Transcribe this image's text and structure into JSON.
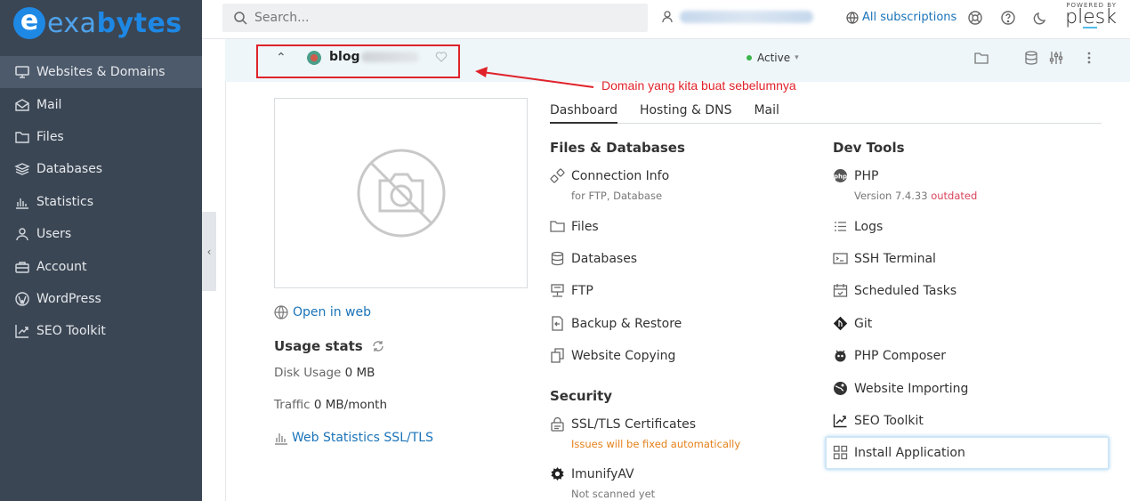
{
  "brand": {
    "logo_letter": "e",
    "logo_text_a": "exa",
    "logo_text_b": "bytes"
  },
  "sidebar": {
    "items": [
      {
        "label": "Websites & Domains",
        "icon": "monitor-icon",
        "active": true
      },
      {
        "label": "Mail",
        "icon": "mail-icon"
      },
      {
        "label": "Files",
        "icon": "folder-icon"
      },
      {
        "label": "Databases",
        "icon": "database-icon"
      },
      {
        "label": "Statistics",
        "icon": "bar-chart-icon"
      },
      {
        "label": "Users",
        "icon": "user-icon"
      },
      {
        "label": "Account",
        "icon": "briefcase-icon"
      },
      {
        "label": "WordPress",
        "icon": "wordpress-icon"
      },
      {
        "label": "SEO Toolkit",
        "icon": "seo-chart-icon"
      }
    ]
  },
  "topbar": {
    "search_placeholder": "Search...",
    "subscriptions_label": "All subscriptions",
    "powered_by": "POWERED BY",
    "plesk": "plesk"
  },
  "domain": {
    "name_prefix": "blog",
    "status": "Active",
    "annotation": "Domain yang kita buat sebelumnya"
  },
  "left": {
    "open_in_web": "Open in web",
    "usage_title": "Usage stats",
    "disk_label": "Disk Usage",
    "disk_value": "0 MB",
    "traffic_label": "Traffic",
    "traffic_value": "0 MB/month",
    "web_stats": "Web Statistics SSL/TLS"
  },
  "tabs": [
    "Dashboard",
    "Hosting & DNS",
    "Mail"
  ],
  "files_db": {
    "title": "Files & Databases",
    "connection": "Connection Info",
    "connection_sub": "for FTP, Database",
    "files": "Files",
    "databases": "Databases",
    "ftp": "FTP",
    "backup": "Backup & Restore",
    "copying": "Website Copying"
  },
  "security": {
    "title": "Security",
    "ssl": "SSL/TLS Certificates",
    "ssl_sub": "Issues will be fixed automatically",
    "imunify": "ImunifyAV",
    "imunify_sub": "Not scanned yet"
  },
  "dev": {
    "title": "Dev Tools",
    "php": "PHP",
    "php_version": "Version 7.4.33",
    "php_outdated": "outdated",
    "logs": "Logs",
    "ssh": "SSH Terminal",
    "tasks": "Scheduled Tasks",
    "git": "Git",
    "composer": "PHP Composer",
    "importing": "Website Importing",
    "seo": "SEO Toolkit",
    "install": "Install Application"
  },
  "colors": {
    "sidebar": "#3b4654",
    "accent": "#1a73b8",
    "annotation": "#e0222a",
    "outdated": "#d9435a",
    "warning": "#e4811a"
  }
}
